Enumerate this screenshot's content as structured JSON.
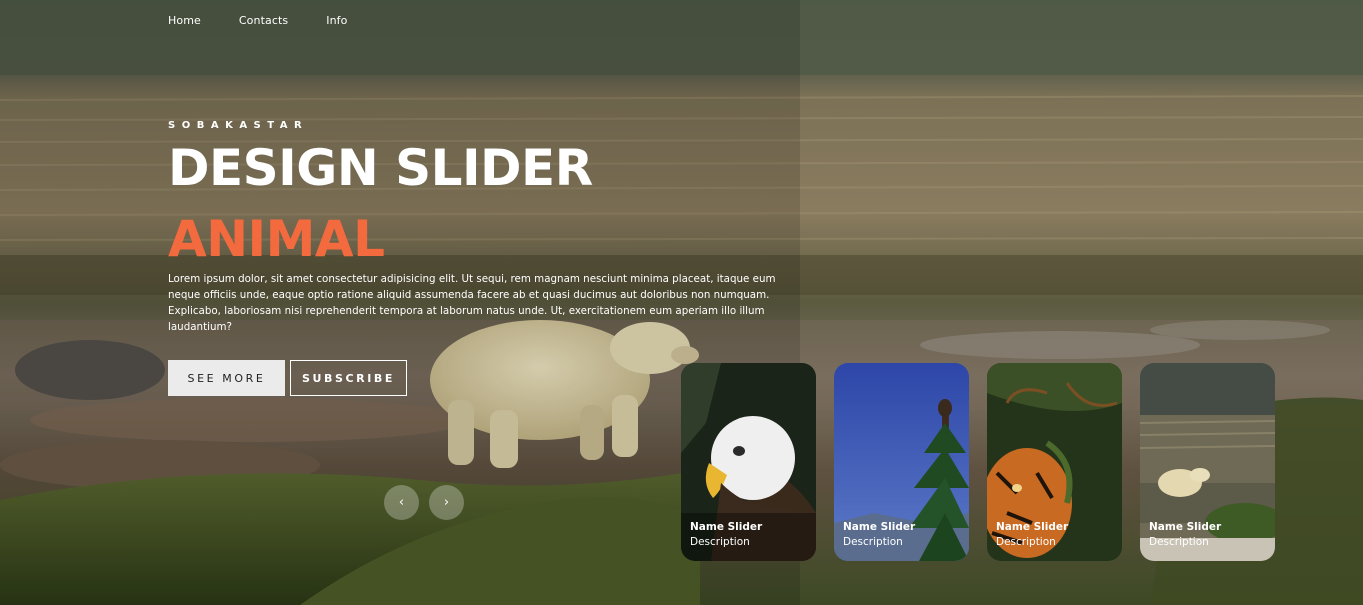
{
  "nav": {
    "items": [
      "Home",
      "Contacts",
      "Info"
    ]
  },
  "hero": {
    "brand": "SOBAKASTAR",
    "title": "DESIGN SLIDER",
    "subtitle": "ANIMAL",
    "description": "Lorem ipsum dolor, sit amet consectetur adipisicing elit. Ut sequi, rem magnam nesciunt minima placeat, itaque eum neque officiis unde, eaque optio ratione aliquid assumenda facere ab et quasi ducimus aut doloribus non numquam. Explicabo, laboriosam nisi reprehenderit tempora at laborum natus unde. Ut, exercitationem eum aperiam illo illum laudantium?",
    "see_more_label": "SEE MORE",
    "subscribe_label": "SUBSCRIBE"
  },
  "controls": {
    "prev_icon": "chevron-left-icon",
    "next_icon": "chevron-right-icon",
    "prev_glyph": "‹",
    "next_glyph": "›"
  },
  "cards": [
    {
      "name": "Name Slider",
      "description": "Description",
      "image": "eagle-image"
    },
    {
      "name": "Name Slider",
      "description": "Description",
      "image": "tree-bird-image"
    },
    {
      "name": "Name Slider",
      "description": "Description",
      "image": "tiger-image"
    },
    {
      "name": "Name Slider",
      "description": "Description",
      "image": "polar-bear-image"
    }
  ],
  "colors": {
    "accent": "#f26a3d",
    "text": "#ffffff",
    "button_bg": "#ebebeb"
  }
}
